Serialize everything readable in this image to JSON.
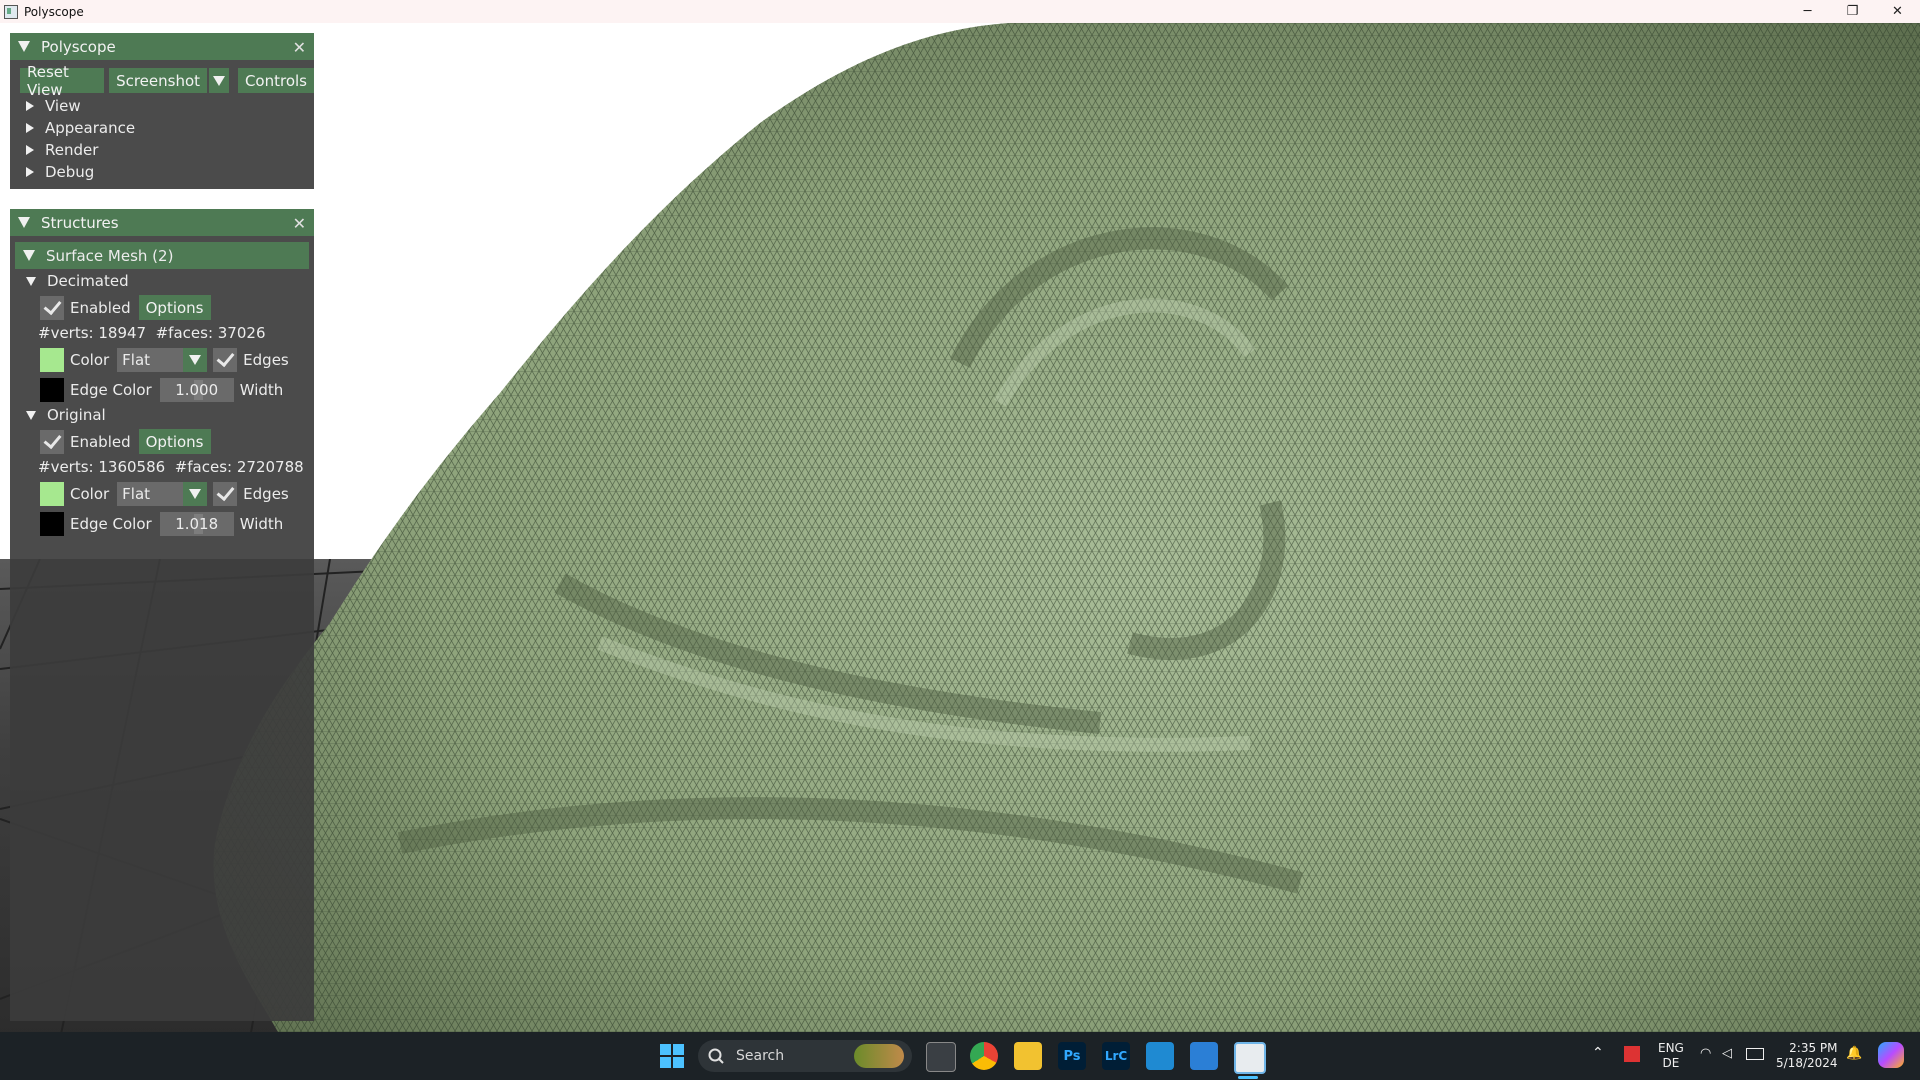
{
  "window": {
    "title": "Polyscope",
    "controls": {
      "minimize": "─",
      "maximize": "❐",
      "close": "✕"
    }
  },
  "polyscope_panel": {
    "title": "Polyscope",
    "close": "✕",
    "buttons": {
      "reset_view": "Reset View",
      "screenshot": "Screenshot",
      "controls": "Controls"
    },
    "sections": [
      "View",
      "Appearance",
      "Render",
      "Debug"
    ]
  },
  "structures_panel": {
    "title": "Structures",
    "close": "✕",
    "group": "Surface Mesh (2)",
    "meshes": [
      {
        "name": "Decimated",
        "enabled_label": "Enabled",
        "enabled": true,
        "options_label": "Options",
        "stats": "#verts: 18947  #faces: 37026",
        "color_label": "Color",
        "color": "#a6e88f",
        "shading": "Flat",
        "edges_label": "Edges",
        "edges": true,
        "edge_color_label": "Edge Color",
        "edge_color": "#000000",
        "width_value": "1.000",
        "width_label": "Width"
      },
      {
        "name": "Original",
        "enabled_label": "Enabled",
        "enabled": true,
        "options_label": "Options",
        "stats": "#verts: 1360586  #faces: 2720788",
        "color_label": "Color",
        "color": "#a6e88f",
        "shading": "Flat",
        "edges_label": "Edges",
        "edges": true,
        "edge_color_label": "Edge Color",
        "edge_color": "#000000",
        "width_value": "1.018",
        "width_label": "Width"
      }
    ]
  },
  "taskbar": {
    "search_placeholder": "Search",
    "apps": [
      "windows-start",
      "widgets",
      "terminal",
      "chrome",
      "file-explorer",
      "photoshop",
      "lightroom-classic",
      "vscode",
      "paint",
      "polyscope"
    ],
    "tray": {
      "language_top": "ENG",
      "language_bottom": "DE",
      "time": "2:35 PM",
      "date": "5/18/2024"
    }
  },
  "colors": {
    "accent": "#4e7a54",
    "panel_bg": "#3c3c3c",
    "mesh_fill": "#9fb48d"
  }
}
